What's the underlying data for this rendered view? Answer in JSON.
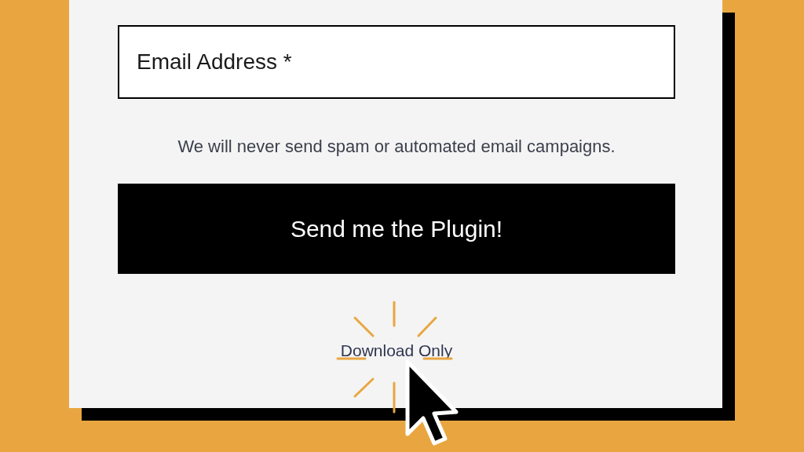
{
  "form": {
    "email_field": {
      "placeholder": "Email Address *"
    },
    "note": "We will never send spam or automated email campaigns.",
    "submit_button": "Send me the Plugin!",
    "download_link": "Download Only"
  }
}
